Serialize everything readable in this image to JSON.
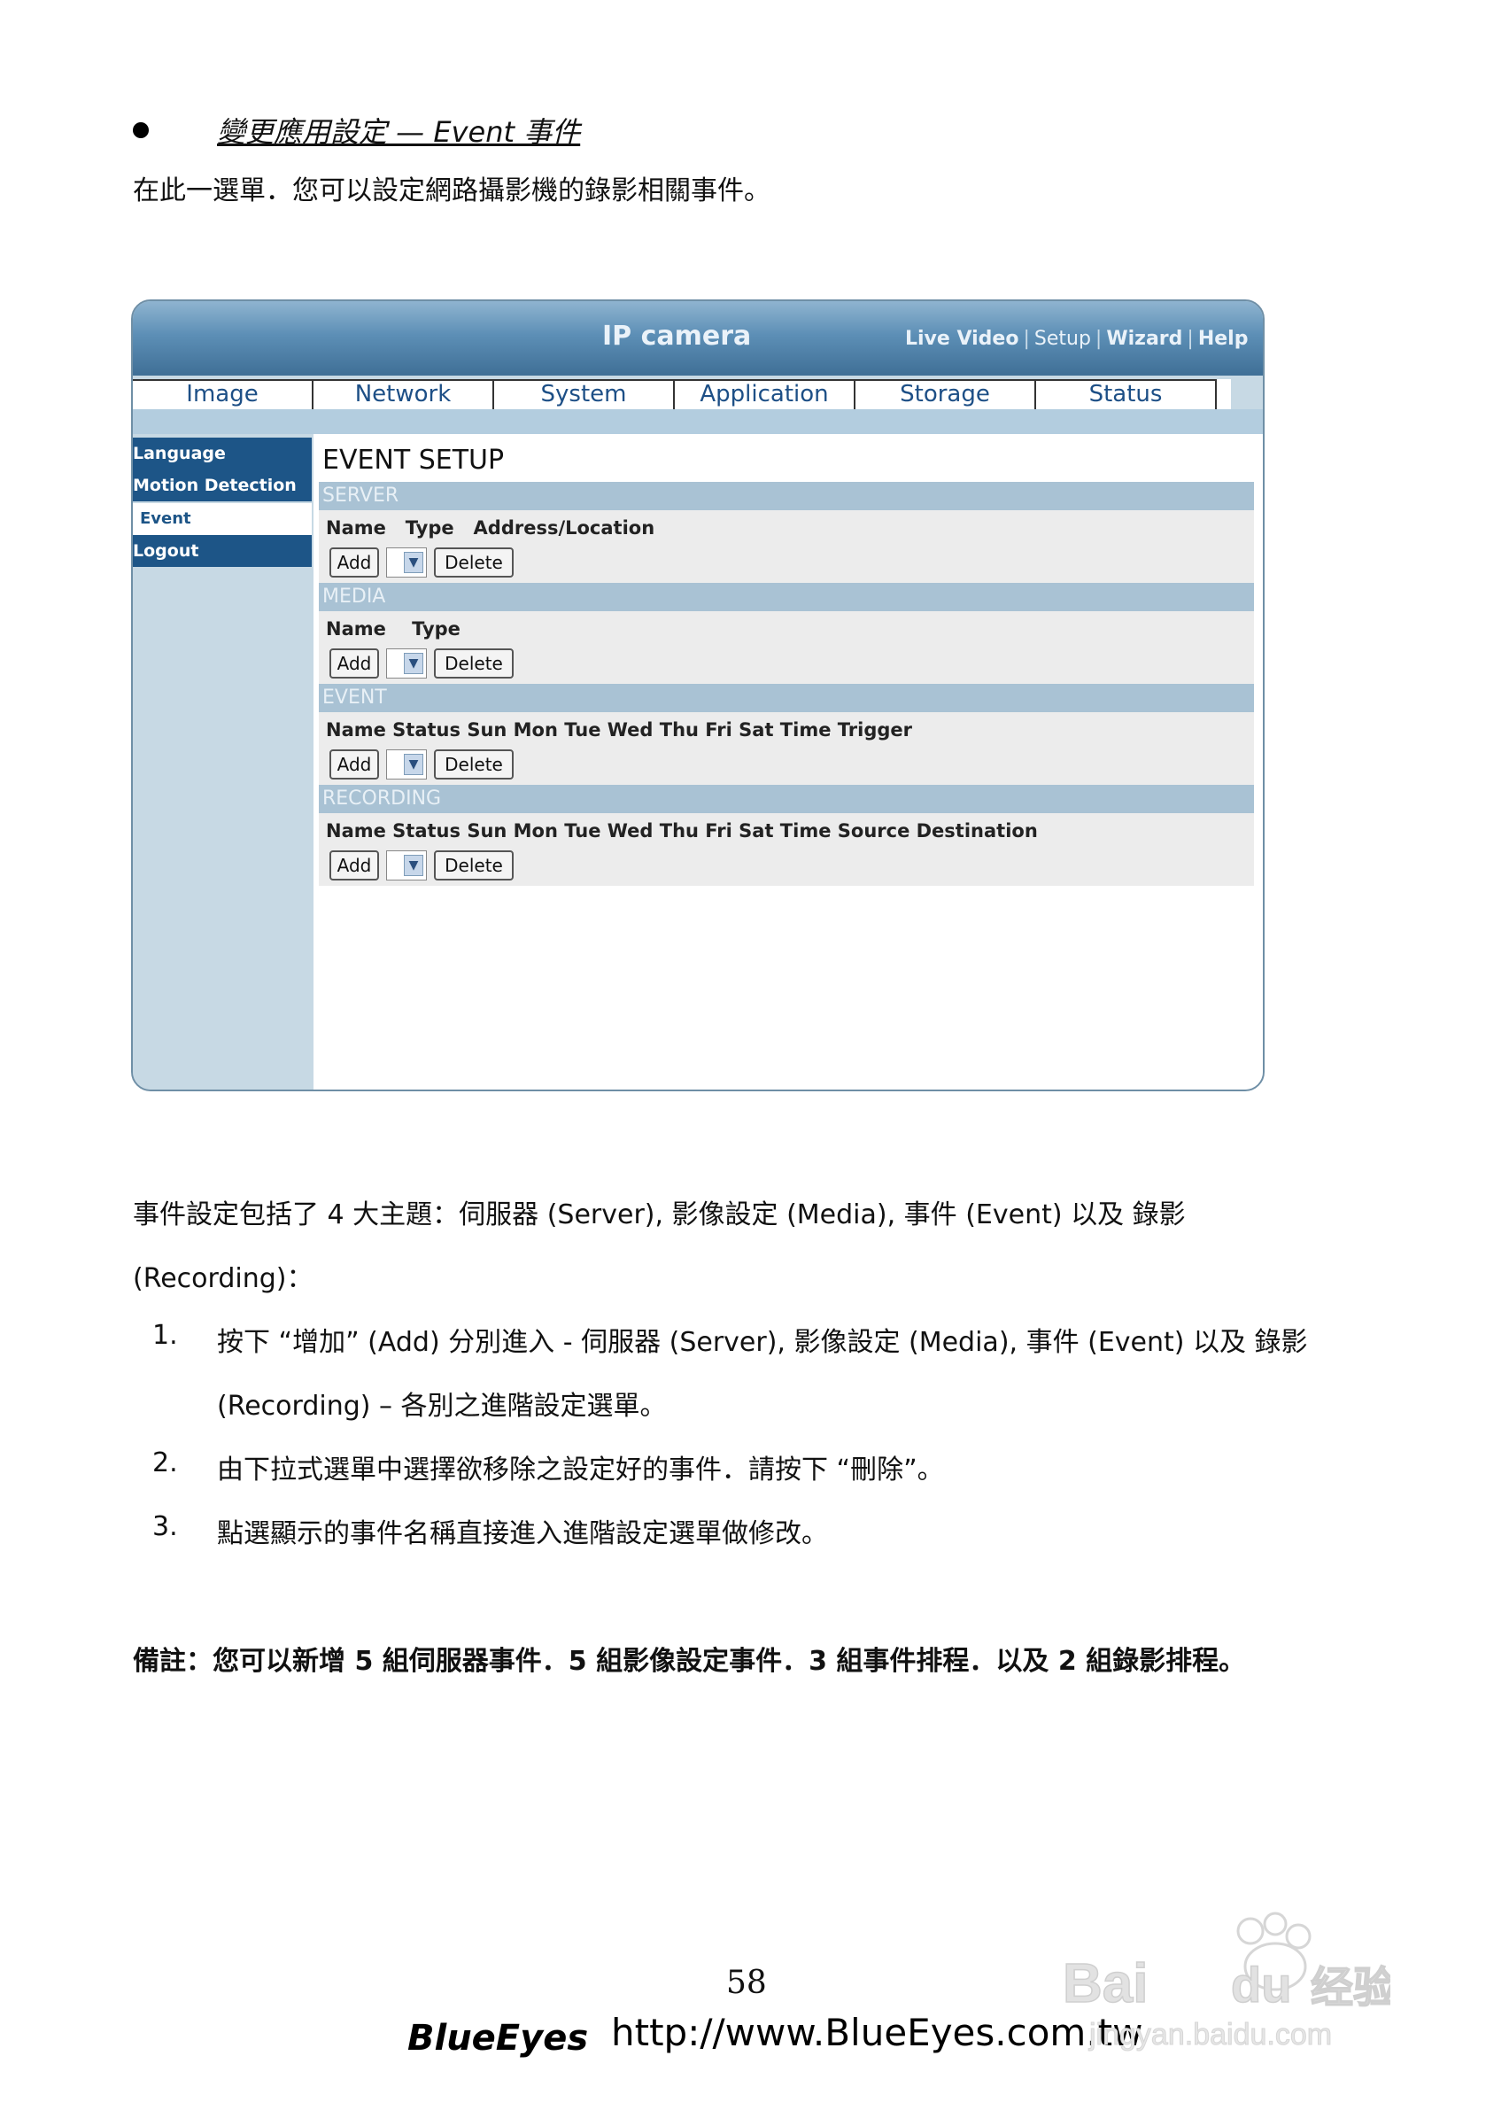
{
  "heading": "變更應用設定 — Event 事件",
  "intro": "在此一選單．您可以設定網路攝影機的錄影相關事件。",
  "camera_ui": {
    "title": "IP camera",
    "top_links": [
      "Live Video",
      "Setup",
      "Wizard",
      "Help"
    ],
    "tabs": [
      "Image",
      "Network",
      "System",
      "Application",
      "Storage",
      "Status"
    ],
    "sidebar": [
      "Language",
      "Motion Detection",
      "Event",
      "Logout"
    ],
    "active_sidebar": "Event",
    "page_title": "EVENT SETUP",
    "sections": [
      {
        "name": "SERVER",
        "columns": "Name   Type   Address/Location",
        "add": "Add",
        "delete": "Delete"
      },
      {
        "name": "MEDIA",
        "columns": "Name    Type",
        "add": "Add",
        "delete": "Delete"
      },
      {
        "name": "EVENT",
        "columns": "Name Status Sun Mon Tue Wed Thu Fri Sat Time Trigger",
        "add": "Add",
        "delete": "Delete"
      },
      {
        "name": "RECORDING",
        "columns": "Name Status Sun Mon Tue Wed Thu Fri Sat Time Source Destination",
        "add": "Add",
        "delete": "Delete"
      }
    ]
  },
  "body": {
    "para1_line1": "事件設定包括了 4 大主題：伺服器 (Server), 影像設定 (Media), 事件 (Event) 以及 錄影",
    "para1_line2": "(Recording)：",
    "items": [
      {
        "num": "1.",
        "line1": "按下 “增加” (Add) 分別進入 - 伺服器 (Server), 影像設定 (Media), 事件 (Event) 以及 錄影",
        "line2": "(Recording) – 各別之進階設定選單。"
      },
      {
        "num": "2.",
        "line1": "由下拉式選單中選擇欲移除之設定好的事件．請按下 “刪除”。",
        "line2": ""
      },
      {
        "num": "3.",
        "line1": "點選顯示的事件名稱直接進入進階設定選單做修改。",
        "line2": ""
      }
    ],
    "note": "備註：您可以新增 5 組伺服器事件．5 組影像設定事件．3 組事件排程．以及 2 組錄影排程。"
  },
  "footer": {
    "page_number": "58",
    "brand": "BlueEyes",
    "url": "http://www.BlueEyes.com.tw"
  },
  "watermark": {
    "text": "Bai du 经验",
    "sub": "jingyan.baidu.com"
  }
}
